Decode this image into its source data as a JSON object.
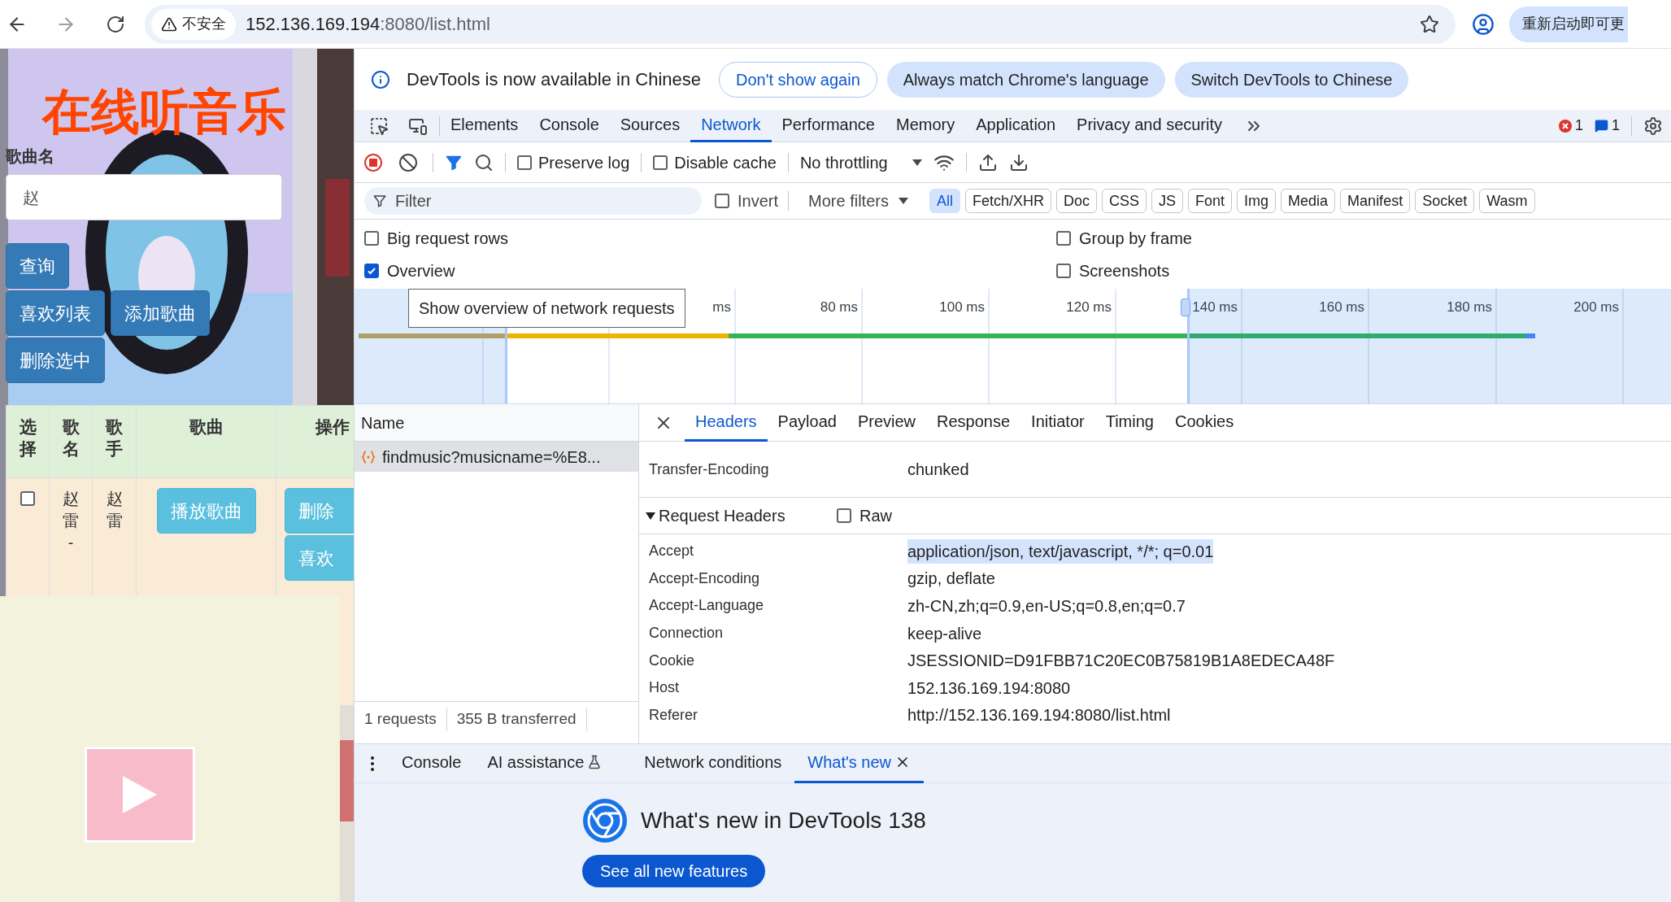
{
  "browser": {
    "security_label": "不安全",
    "url_host": "152.136.169.194",
    "url_rest": ":8080/list.html",
    "relaunch_button": "重新启动即可更"
  },
  "page": {
    "title": "在线听音乐",
    "search_label": "歌曲名",
    "search_value": "赵",
    "button_rows": [
      {
        "buttons": [
          "查询"
        ]
      },
      {
        "buttons": [
          "喜欢列表",
          "添加歌曲"
        ]
      },
      {
        "buttons": [
          "删除选中"
        ]
      }
    ],
    "table": {
      "columns": [
        "选择",
        "歌名",
        "歌手",
        "歌曲",
        "操作"
      ],
      "rows": [
        {
          "checked": false,
          "song": "赵雷-",
          "singer": "赵雷",
          "play_button": "播放歌曲",
          "actions": [
            "删除",
            "喜欢"
          ]
        }
      ]
    }
  },
  "devtools": {
    "infobar": {
      "message": "DevTools is now available in Chinese",
      "buttons": [
        {
          "label": "Don't show again",
          "kind": "outline"
        },
        {
          "label": "Always match Chrome's language",
          "kind": "tonal"
        },
        {
          "label": "Switch DevTools to Chinese",
          "kind": "tonal"
        }
      ]
    },
    "tabs": [
      {
        "label": "Elements",
        "selected": false
      },
      {
        "label": "Console",
        "selected": false
      },
      {
        "label": "Sources",
        "selected": false
      },
      {
        "label": "Network",
        "selected": true
      },
      {
        "label": "Performance",
        "selected": false
      },
      {
        "label": "Memory",
        "selected": false
      },
      {
        "label": "Application",
        "selected": false
      },
      {
        "label": "Privacy and security",
        "selected": false
      }
    ],
    "error_count": "1",
    "message_count": "1",
    "toolbar": {
      "checks": [
        {
          "label": "Preserve log",
          "checked": false
        },
        {
          "label": "Disable cache",
          "checked": false
        }
      ],
      "throttling": "No throttling"
    },
    "filter": {
      "placeholder": "Filter",
      "invert": {
        "label": "Invert",
        "checked": false
      },
      "more_filters": "More filters",
      "types": [
        {
          "label": "All",
          "selected": true
        },
        {
          "label": "Fetch/XHR",
          "selected": false
        },
        {
          "label": "Doc",
          "selected": false
        },
        {
          "label": "CSS",
          "selected": false
        },
        {
          "label": "JS",
          "selected": false
        },
        {
          "label": "Font",
          "selected": false
        },
        {
          "label": "Img",
          "selected": false
        },
        {
          "label": "Media",
          "selected": false
        },
        {
          "label": "Manifest",
          "selected": false
        },
        {
          "label": "Socket",
          "selected": false
        },
        {
          "label": "Wasm",
          "selected": false
        }
      ]
    },
    "options": [
      {
        "label": "Big request rows",
        "checked": false
      },
      {
        "label": "Group by frame",
        "checked": false
      },
      {
        "label": "Overview",
        "checked": true
      },
      {
        "label": "Screenshots",
        "checked": false
      }
    ],
    "overview": {
      "tooltip": "Show overview of network requests",
      "ticks": [
        "ms",
        "80 ms",
        "100 ms",
        "120 ms",
        "140 ms",
        "160 ms",
        "180 ms",
        "200 ms"
      ]
    },
    "requests": {
      "header": "Name",
      "items": [
        {
          "name": "findmusic?musicname=%E8...",
          "selected": true
        }
      ],
      "count": "1 requests",
      "transferred": "355 B transferred"
    },
    "detail_tabs": [
      {
        "label": "Headers",
        "selected": true
      },
      {
        "label": "Payload",
        "selected": false
      },
      {
        "label": "Preview",
        "selected": false
      },
      {
        "label": "Response",
        "selected": false
      },
      {
        "label": "Initiator",
        "selected": false
      },
      {
        "label": "Timing",
        "selected": false
      },
      {
        "label": "Cookies",
        "selected": false
      }
    ],
    "response_headers": [
      {
        "name": "Transfer-Encoding",
        "value": "chunked"
      }
    ],
    "request_headers": {
      "title": "Request Headers",
      "expanded": true,
      "raw": {
        "label": "Raw",
        "checked": false
      },
      "rows": [
        {
          "name": "Accept",
          "value": "application/json, text/javascript, */*; q=0.01",
          "highlighted": true
        },
        {
          "name": "Accept-Encoding",
          "value": "gzip, deflate",
          "highlighted": false
        },
        {
          "name": "Accept-Language",
          "value": "zh-CN,zh;q=0.9,en-US;q=0.8,en;q=0.7",
          "highlighted": false
        },
        {
          "name": "Connection",
          "value": "keep-alive",
          "highlighted": false
        },
        {
          "name": "Cookie",
          "value": "JSESSIONID=D91FBB71C20EC0B75819B1A8EDECA48F",
          "highlighted": false
        },
        {
          "name": "Host",
          "value": "152.136.169.194:8080",
          "highlighted": false
        },
        {
          "name": "Referer",
          "value": "http://152.136.169.194:8080/list.html",
          "highlighted": false
        }
      ]
    },
    "drawer_tabs": [
      {
        "label": "Console",
        "selected": false,
        "kind": "plain"
      },
      {
        "label": "AI assistance",
        "selected": false,
        "kind": "experimental"
      },
      {
        "label": "Network conditions",
        "selected": false,
        "kind": "plain"
      },
      {
        "label": "What's new",
        "selected": true,
        "kind": "closable"
      }
    ],
    "whats_new": {
      "title": "What's new in DevTools 138",
      "button": "See all new features"
    }
  }
}
